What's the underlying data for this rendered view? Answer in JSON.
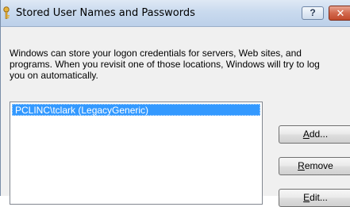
{
  "window": {
    "title": "Stored User Names and Passwords",
    "help_label": "?",
    "close_label": "✕"
  },
  "description": "Windows can store your logon credentials for servers, Web sites, and programs. When you revisit one of those locations, Windows will try to log you on automatically.",
  "credentials": [
    {
      "label": "PCLINC\\tclark (LegacyGeneric)",
      "selected": true
    }
  ],
  "buttons": {
    "add": {
      "first": "A",
      "rest": "dd..."
    },
    "remove": {
      "first": "R",
      "rest": "emove"
    },
    "edit": {
      "first": "E",
      "rest": "dit..."
    }
  },
  "colors": {
    "selection": "#3399ff",
    "close_button": "#c24a2c",
    "titlebar": "#c9daee"
  },
  "icons": [
    "key-icon",
    "help-icon",
    "close-icon"
  ]
}
